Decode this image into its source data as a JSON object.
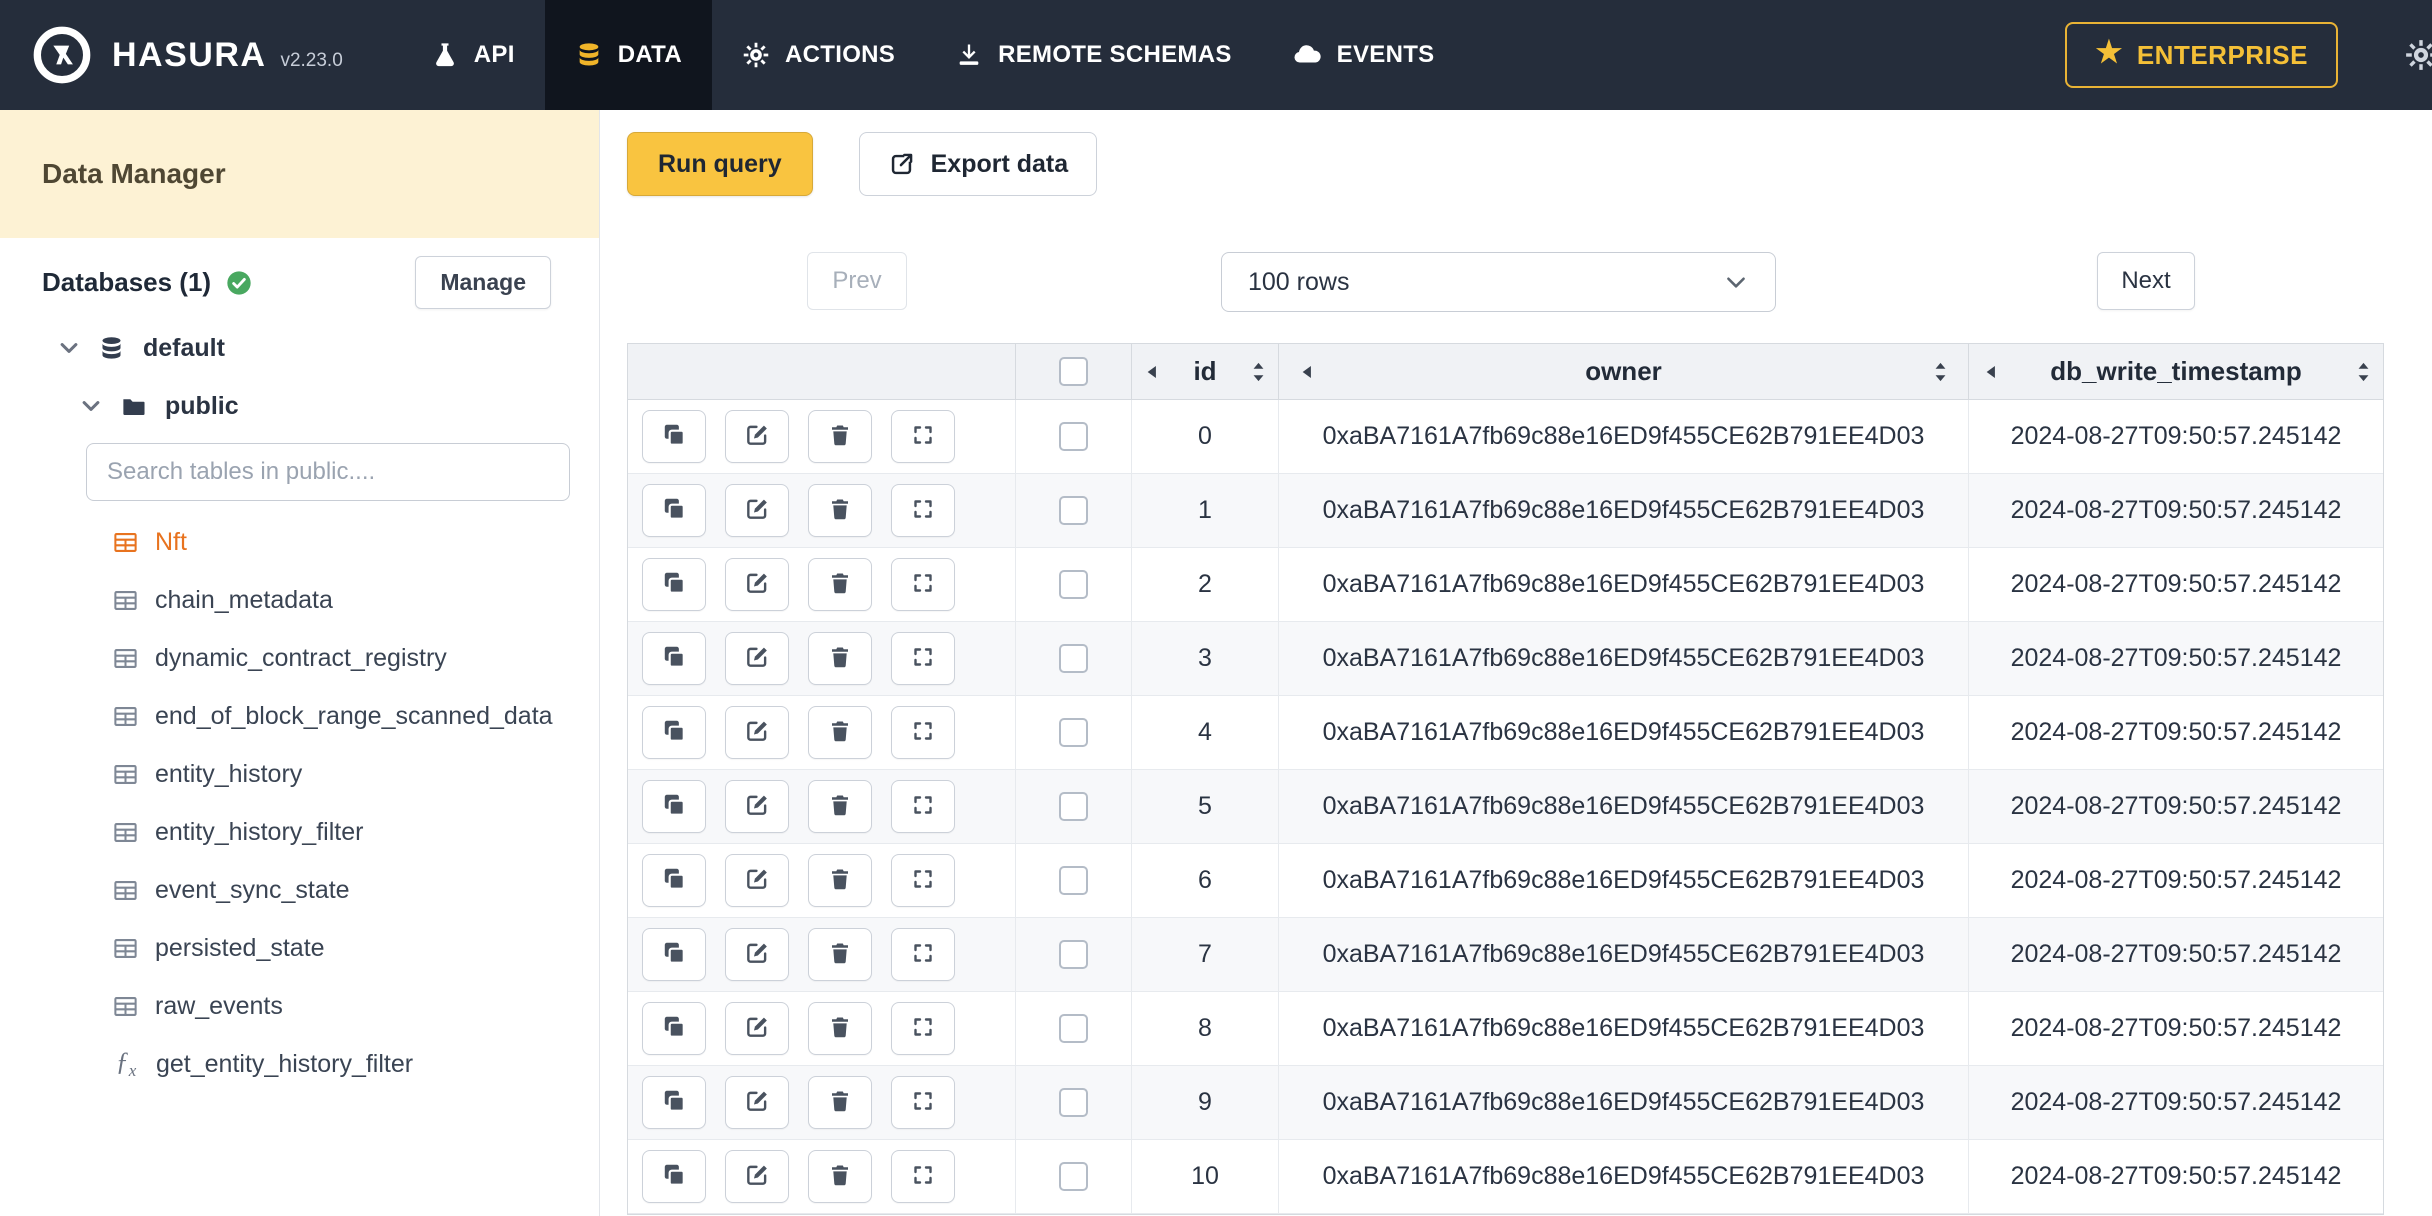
{
  "navbar": {
    "brand": "HASURA",
    "version": "v2.23.0",
    "items": [
      {
        "label": "API"
      },
      {
        "label": "DATA"
      },
      {
        "label": "ACTIONS"
      },
      {
        "label": "REMOTE SCHEMAS"
      },
      {
        "label": "EVENTS"
      }
    ],
    "enterprise_label": "ENTERPRISE"
  },
  "sidebar": {
    "title": "Data Manager",
    "databases_label": "Databases (1)",
    "manage_label": "Manage",
    "database_name": "default",
    "schema_name": "public",
    "search_placeholder": "Search tables in public....",
    "tables": [
      {
        "label": "Nft",
        "cls": "accent"
      },
      {
        "label": "chain_metadata"
      },
      {
        "label": "dynamic_contract_registry"
      },
      {
        "label": "end_of_block_range_scanned_data"
      },
      {
        "label": "entity_history"
      },
      {
        "label": "entity_history_filter"
      },
      {
        "label": "event_sync_state"
      },
      {
        "label": "persisted_state"
      },
      {
        "label": "raw_events"
      }
    ],
    "functions": [
      {
        "label": "get_entity_history_filter"
      }
    ]
  },
  "toolbar": {
    "run_query_label": "Run query",
    "export_label": "Export data"
  },
  "pagination": {
    "prev_label": "Prev",
    "rows_value": "100 rows",
    "next_label": "Next"
  },
  "grid": {
    "columns": [
      {
        "label": "id"
      },
      {
        "label": "owner"
      },
      {
        "label": "db_write_timestamp"
      }
    ],
    "rows": [
      {
        "id": "0",
        "owner": "0xaBA7161A7fb69c88e16ED9f455CE62B791EE4D03",
        "db_write_timestamp": "2024-08-27T09:50:57.245142"
      },
      {
        "id": "1",
        "owner": "0xaBA7161A7fb69c88e16ED9f455CE62B791EE4D03",
        "db_write_timestamp": "2024-08-27T09:50:57.245142"
      },
      {
        "id": "2",
        "owner": "0xaBA7161A7fb69c88e16ED9f455CE62B791EE4D03",
        "db_write_timestamp": "2024-08-27T09:50:57.245142"
      },
      {
        "id": "3",
        "owner": "0xaBA7161A7fb69c88e16ED9f455CE62B791EE4D03",
        "db_write_timestamp": "2024-08-27T09:50:57.245142"
      },
      {
        "id": "4",
        "owner": "0xaBA7161A7fb69c88e16ED9f455CE62B791EE4D03",
        "db_write_timestamp": "2024-08-27T09:50:57.245142"
      },
      {
        "id": "5",
        "owner": "0xaBA7161A7fb69c88e16ED9f455CE62B791EE4D03",
        "db_write_timestamp": "2024-08-27T09:50:57.245142"
      },
      {
        "id": "6",
        "owner": "0xaBA7161A7fb69c88e16ED9f455CE62B791EE4D03",
        "db_write_timestamp": "2024-08-27T09:50:57.245142"
      },
      {
        "id": "7",
        "owner": "0xaBA7161A7fb69c88e16ED9f455CE62B791EE4D03",
        "db_write_timestamp": "2024-08-27T09:50:57.245142"
      },
      {
        "id": "8",
        "owner": "0xaBA7161A7fb69c88e16ED9f455CE62B791EE4D03",
        "db_write_timestamp": "2024-08-27T09:50:57.245142"
      },
      {
        "id": "9",
        "owner": "0xaBA7161A7fb69c88e16ED9f455CE62B791EE4D03",
        "db_write_timestamp": "2024-08-27T09:50:57.245142"
      },
      {
        "id": "10",
        "owner": "0xaBA7161A7fb69c88e16ED9f455CE62B791EE4D03",
        "db_write_timestamp": "2024-08-27T09:50:57.245142"
      }
    ]
  },
  "colors": {
    "navbar_bg": "#252d3b",
    "accent_yellow": "#f9c440",
    "enterprise_gold": "#f5c037",
    "table_accent_orange": "#e8731f",
    "success_green": "#49a860"
  }
}
